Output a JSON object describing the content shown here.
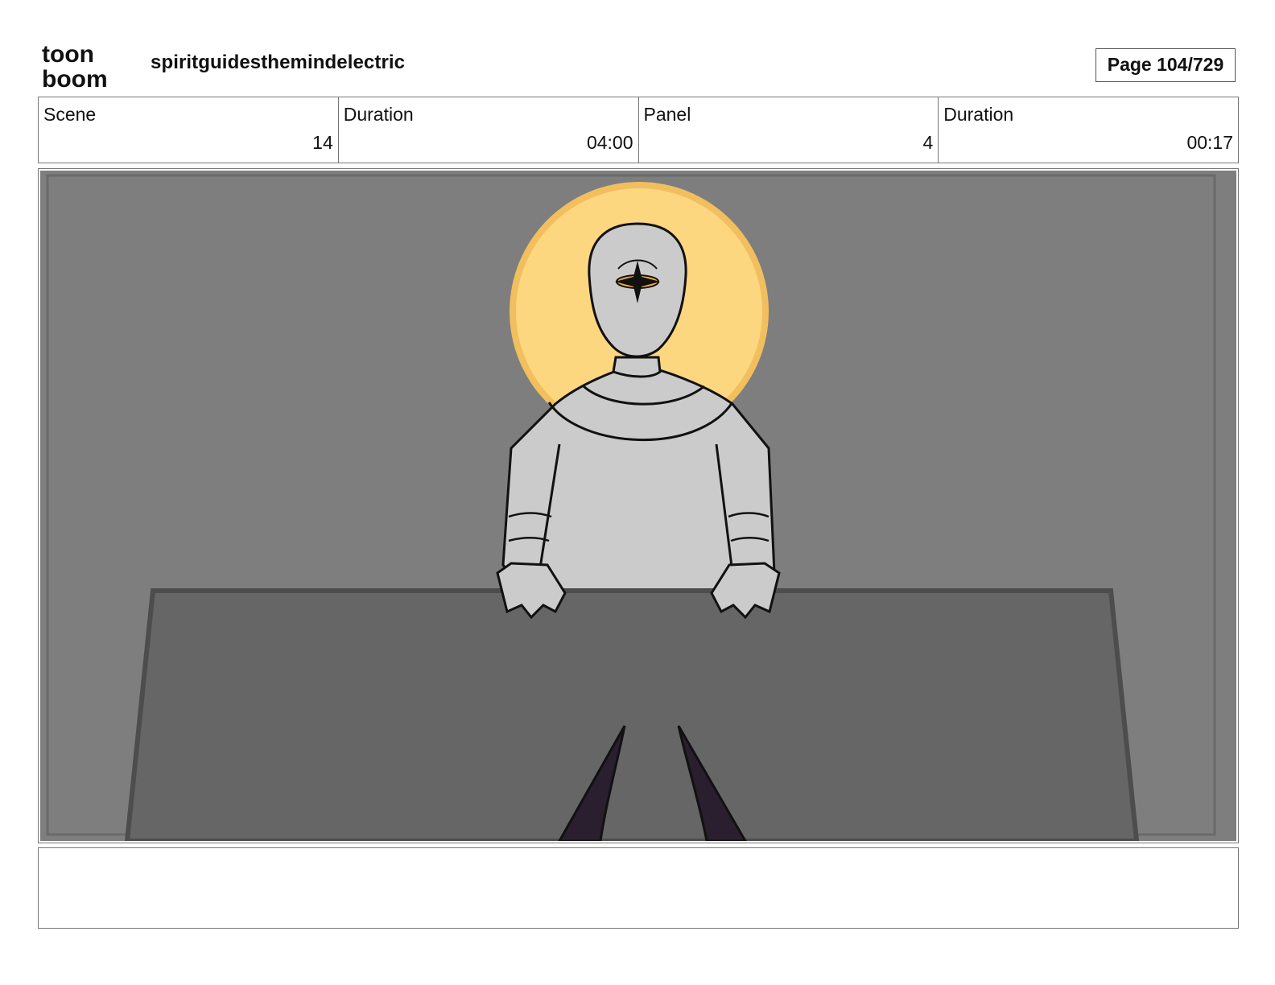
{
  "header": {
    "logo_line1": "toon",
    "logo_line2": "boom",
    "project_title": "spiritguidesthemindelectric",
    "page_label": "Page 104/729"
  },
  "info": [
    {
      "label": "Scene",
      "value": "14"
    },
    {
      "label": "Duration",
      "value": "04:00"
    },
    {
      "label": "Panel",
      "value": "4"
    },
    {
      "label": "Duration",
      "value": "00:17"
    }
  ],
  "panel_image": {
    "colors": {
      "background": "#7e7e7e",
      "halo": "#fdd680",
      "halo_rim": "#f2bf5e",
      "figure": "#cbcbcb",
      "desk": "#666666",
      "desk_edge": "#4d4d4d",
      "foreground_horns": "#2a1f2e",
      "eye": "#f2a93b"
    }
  },
  "notes": {
    "text": ""
  }
}
